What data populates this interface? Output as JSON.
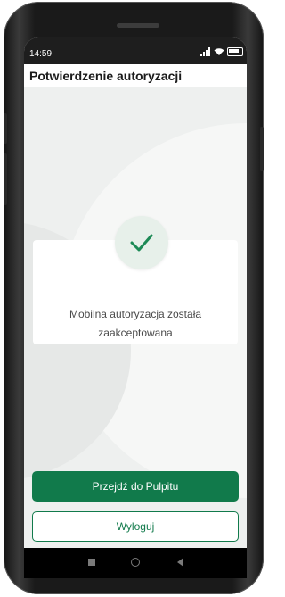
{
  "status_bar": {
    "time": "14:59",
    "icons": [
      "signal-icon",
      "wifi-icon",
      "battery-icon"
    ]
  },
  "header": {
    "title": "Potwierdzenie autoryzacji"
  },
  "confirmation": {
    "icon": "checkmark-icon",
    "message_line1": "Mobilna autoryzacja została",
    "message_line2": "zaakceptowana"
  },
  "actions": {
    "primary_label": "Przejdź do Pulpitu",
    "secondary_label": "Wyloguj"
  },
  "navigation": {
    "buttons": [
      "recent-apps-icon",
      "home-icon",
      "back-icon"
    ]
  },
  "colors": {
    "accent": "#117a4b",
    "check": "#1d8a56",
    "check_bg": "#e7f0ea"
  }
}
